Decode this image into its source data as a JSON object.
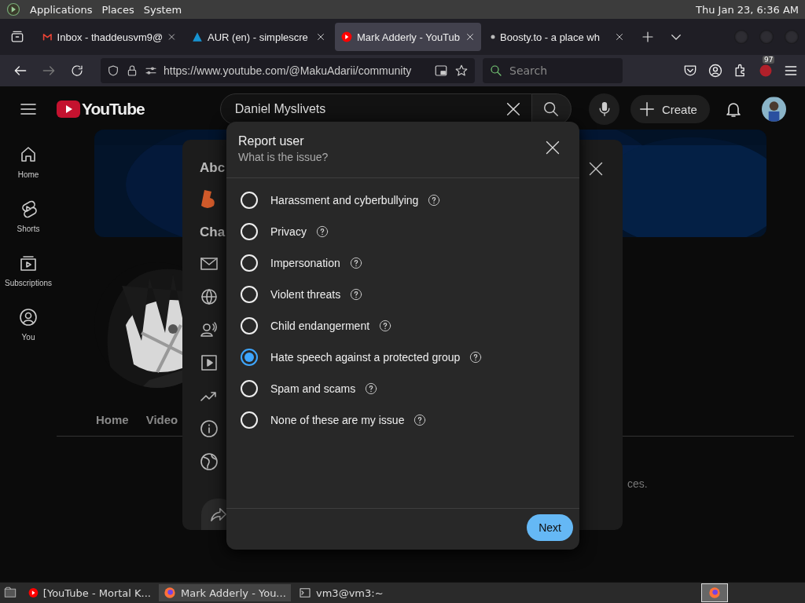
{
  "top_panel": {
    "menus": [
      "Applications",
      "Places",
      "System"
    ],
    "clock": "Thu Jan 23,  6:36 AM"
  },
  "browser": {
    "tabs": [
      {
        "title": "Inbox - thaddeusvm9@",
        "kind": "mail",
        "selected": false
      },
      {
        "title": "AUR (en) - simplescre",
        "kind": "arch",
        "selected": false
      },
      {
        "title": "Mark Adderly - YouTub",
        "kind": "youtube",
        "selected": true
      },
      {
        "title": "Boosty.to - a place wh",
        "kind": "dot",
        "selected": false
      }
    ],
    "address": "https://www.youtube.com/@MakuAdarii/community",
    "search_placeholder": "Search",
    "extension_badge": "97"
  },
  "youtube": {
    "logo": "YouTube",
    "search_value": "Daniel Myslivets",
    "create": "Create",
    "sidebar": [
      {
        "label": "Home",
        "kind": "home"
      },
      {
        "label": "Shorts",
        "kind": "shorts"
      },
      {
        "label": "Subscriptions",
        "kind": "subscriptions"
      },
      {
        "label": "You",
        "kind": "you"
      }
    ],
    "channel_tabs": [
      "Home",
      "Video"
    ],
    "partial_text": "ces."
  },
  "about_panel": {
    "title": "Abc",
    "section": "Cha"
  },
  "dialog": {
    "title": "Report user",
    "subtitle": "What is the issue?",
    "options": [
      {
        "label": "Harassment and cyberbullying",
        "selected": false
      },
      {
        "label": "Privacy",
        "selected": false
      },
      {
        "label": "Impersonation",
        "selected": false
      },
      {
        "label": "Violent threats",
        "selected": false
      },
      {
        "label": "Child endangerment",
        "selected": false
      },
      {
        "label": "Hate speech against a protected group",
        "selected": true
      },
      {
        "label": "Spam and scams",
        "selected": false
      },
      {
        "label": "None of these are my issue",
        "selected": false
      }
    ],
    "next": "Next"
  },
  "taskbar": {
    "items": [
      {
        "title": "[YouTube - Mortal K...",
        "kind": "youtube",
        "selected": false
      },
      {
        "title": "Mark Adderly - You...",
        "kind": "firefox",
        "selected": true
      },
      {
        "title": "vm3@vm3:~",
        "kind": "terminal",
        "selected": false
      }
    ]
  }
}
